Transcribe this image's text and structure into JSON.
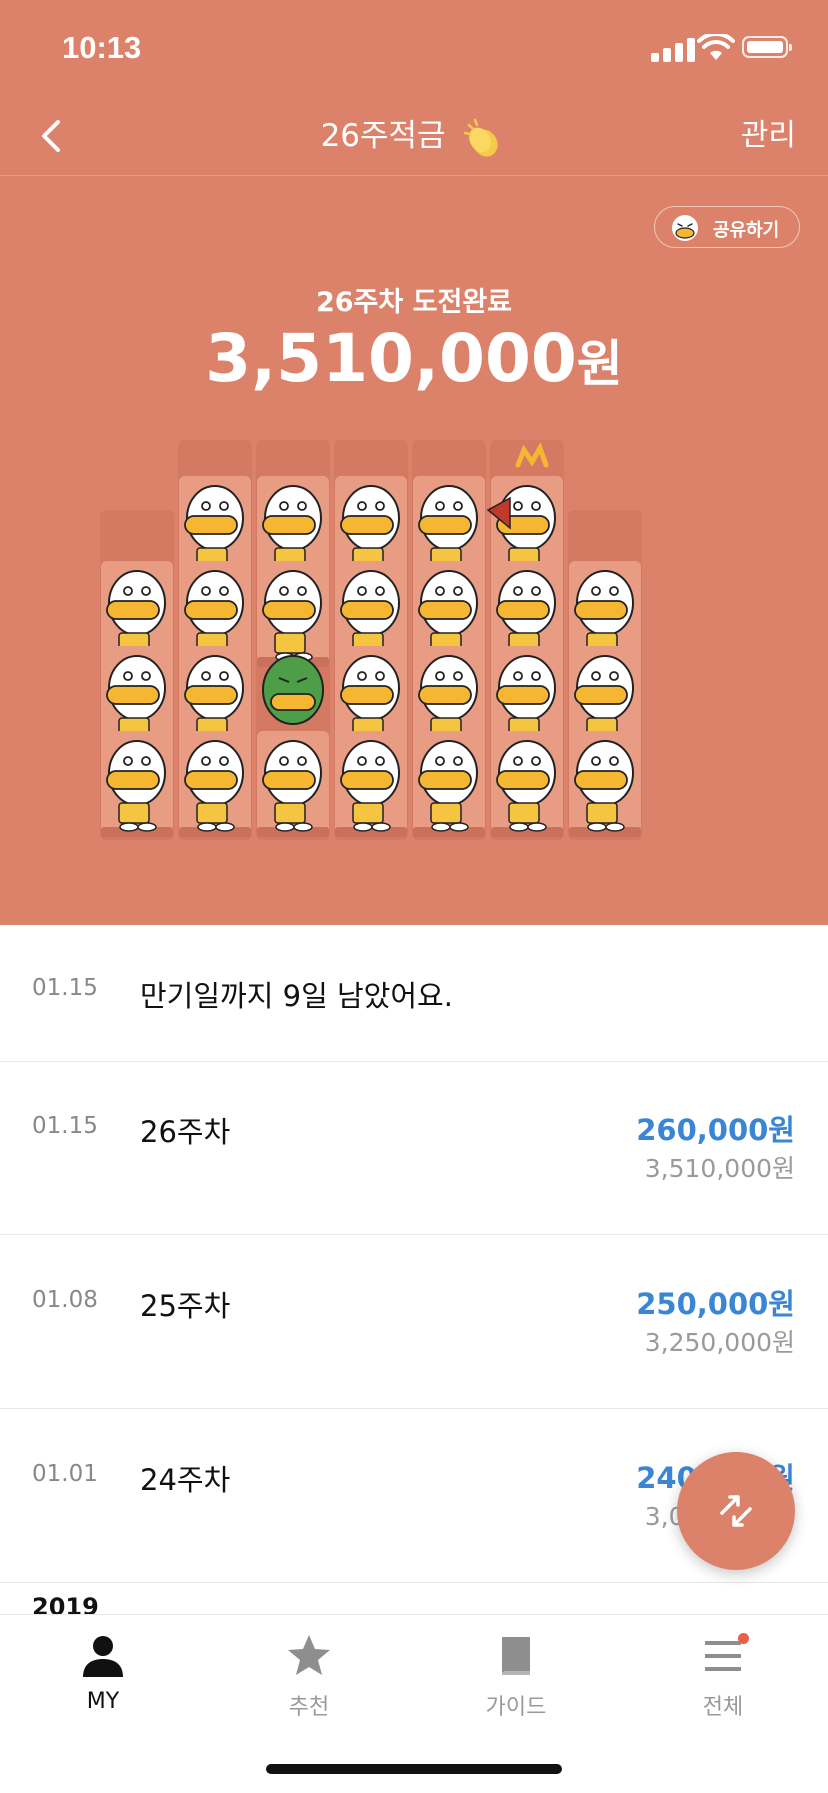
{
  "status_bar": {
    "time": "10:13"
  },
  "nav": {
    "title": "26주적금",
    "manage_label": "관리"
  },
  "hero": {
    "share_label": "공유하기",
    "challenge_label": "26주차 도전완료",
    "total_amount": "3,510,000",
    "total_unit": "원"
  },
  "notice": {
    "date": "01.15",
    "text": "만기일까지 9일 남았어요."
  },
  "entries": [
    {
      "date": "01.15",
      "week": "26주차",
      "amount": "260,000원",
      "cumulative": "3,510,000원"
    },
    {
      "date": "01.08",
      "week": "25주차",
      "amount": "250,000원",
      "cumulative": "3,250,000원"
    },
    {
      "date": "01.01",
      "week": "24주차",
      "amount": "240,000원",
      "cumulative": "3,000,000원"
    }
  ],
  "year_header": "2019",
  "tabs": [
    {
      "label": "MY",
      "icon": "person-icon",
      "active": true
    },
    {
      "label": "추천",
      "icon": "star-icon",
      "active": false
    },
    {
      "label": "가이드",
      "icon": "book-icon",
      "active": false
    },
    {
      "label": "전체",
      "icon": "menu-icon",
      "active": false,
      "badge": true
    }
  ],
  "colors": {
    "accent": "#DD826A",
    "amount_blue": "#3A86D5",
    "badge_red": "#E8604A"
  }
}
